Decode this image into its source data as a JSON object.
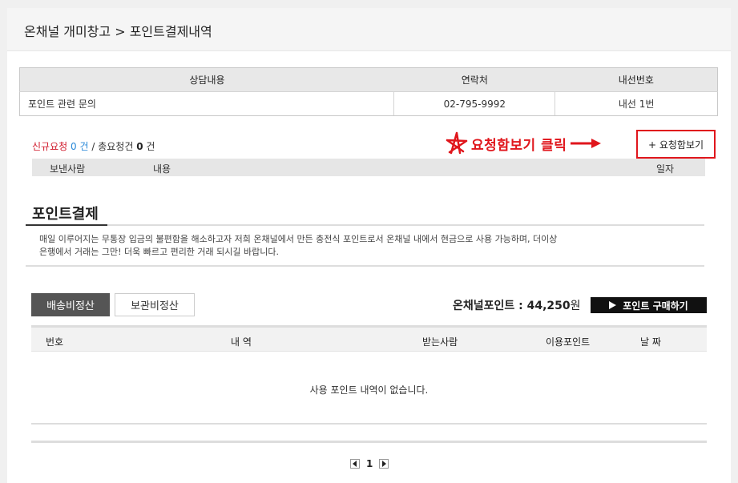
{
  "header": {
    "title": "온채널 개미창고 > 포인트결제내역"
  },
  "contact_table": {
    "headers": [
      "상담내용",
      "연락처",
      "내선번호"
    ],
    "rows": [
      [
        "포인트 관련 문의",
        "02-795-9992",
        "내선 1번"
      ]
    ]
  },
  "requests": {
    "new_label": "신규요청",
    "new_count": "0",
    "new_unit": "건",
    "sep": "/",
    "total_label": "총요청건",
    "total_count": "0",
    "total_unit": "건"
  },
  "annotation": {
    "text": "요청함보기 클릭"
  },
  "view_requests_button": "+ 요청함보기",
  "message_table": {
    "headers": [
      "보낸사람",
      "내용",
      "일자"
    ]
  },
  "section": {
    "title": "포인트결제",
    "desc_line1": "매일 이루어지는 무통장 입금의 불편함을 해소하고자 저희 온채널에서 만든 충전식 포인트로서 온채널 내에서 현금으로 사용 가능하며, 더이상",
    "desc_line2": "은행에서 거래는 그만! 더욱 빠르고 편리한 거래 되시길 바랍니다."
  },
  "tabs": [
    "배송비정산",
    "보관비정산"
  ],
  "points": {
    "label": "온채널포인트 : 44,250",
    "unit": "원"
  },
  "buy_button": "포인트 구매하기",
  "points_table": {
    "headers": [
      "번호",
      "내 역",
      "받는사람",
      "이용포인트",
      "날 짜"
    ],
    "empty_message": "사용 포인트 내역이 없습니다."
  },
  "pagination": {
    "current": "1"
  },
  "colors": {
    "annotation": "#e0161c",
    "new_request": "#d0182a",
    "count_blue": "#2a89d8",
    "active_tab": "#555555"
  }
}
